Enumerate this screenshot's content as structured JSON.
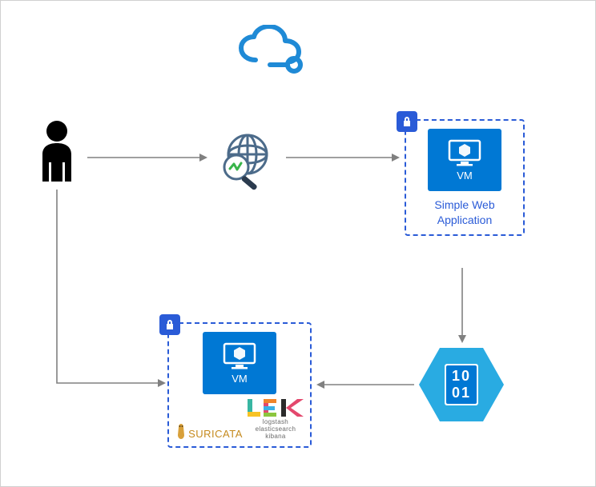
{
  "nodes": {
    "user": {
      "name": "user-icon"
    },
    "cloud": {
      "name": "cloud-icon"
    },
    "inspect": {
      "name": "globe-inspect-icon"
    },
    "webapp": {
      "vm_label": "VM",
      "caption": "Simple Web\nApplication",
      "lock_name": "lock-icon"
    },
    "processing_vm": {
      "vm_label": "VM",
      "lock_name": "lock-icon",
      "logos": {
        "suricata": "SURICATA",
        "lek_brand": "LEK",
        "lek_sub": "logstash  elasticsearch  kibana"
      }
    },
    "binary_hex": {
      "line1": "10",
      "line2": "01"
    }
  },
  "arrows": {
    "user_to_inspect": "→",
    "inspect_to_webapp": "→",
    "webapp_to_hex": "↓",
    "hex_to_vm": "←",
    "user_to_vm": "↓→"
  }
}
